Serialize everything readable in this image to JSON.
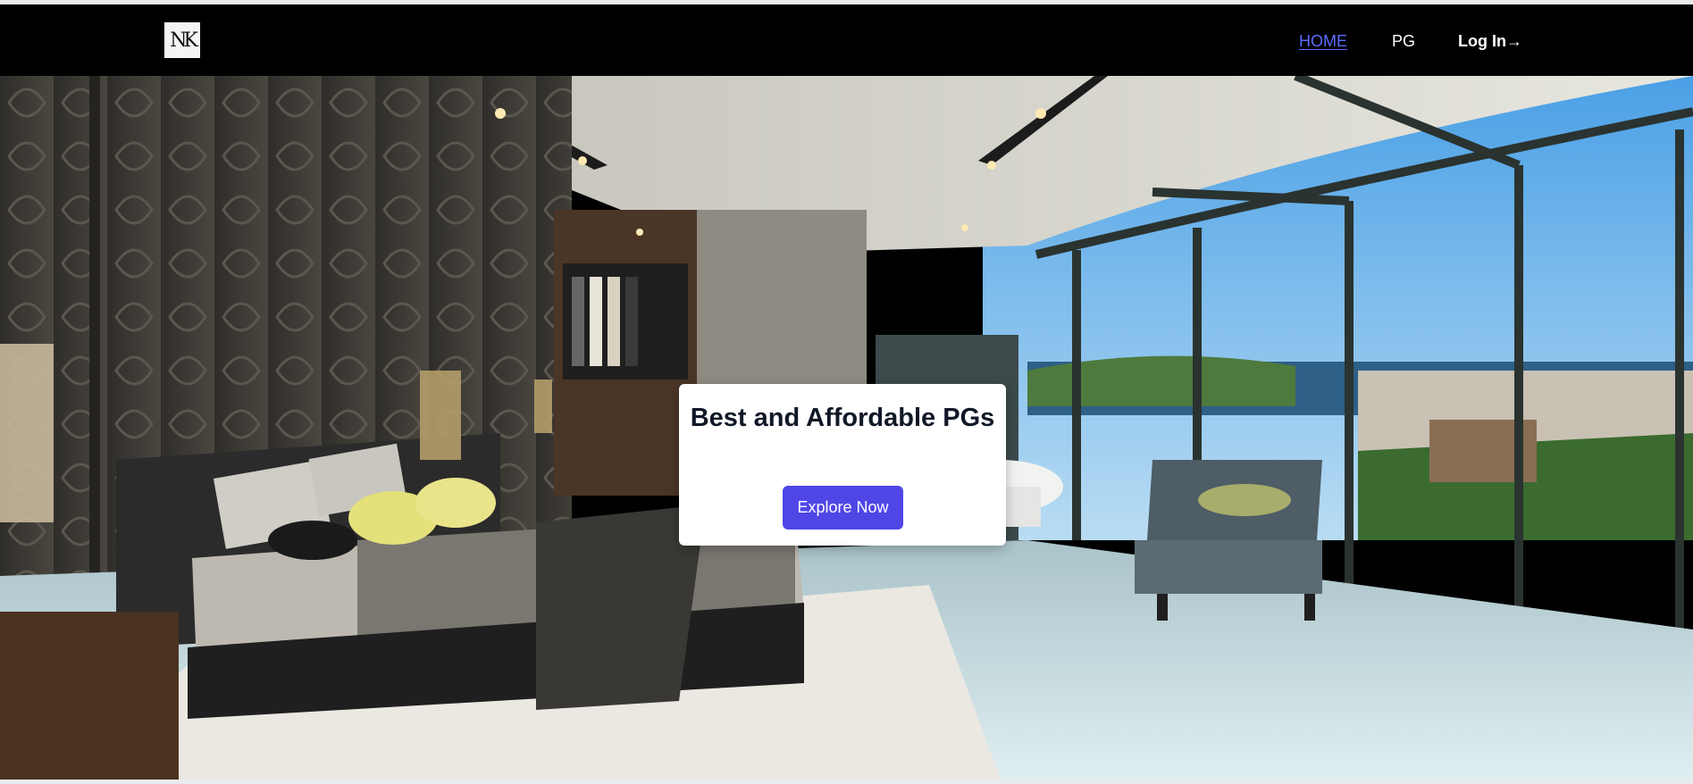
{
  "navbar": {
    "logo_text": "NK",
    "links": [
      {
        "label": "HOME",
        "active": true
      },
      {
        "label": "PG",
        "active": false
      },
      {
        "label": "Log In→",
        "active": false
      }
    ]
  },
  "hero": {
    "title": "Best and Affordable PGs",
    "cta_label": "Explore Now",
    "background": "luxury bedroom with panoramic glass wall and harbor view"
  },
  "colors": {
    "nav_bg": "#000000",
    "active_link": "#5b6cff",
    "cta_bg": "#4f46e5",
    "card_bg": "#ffffff"
  }
}
